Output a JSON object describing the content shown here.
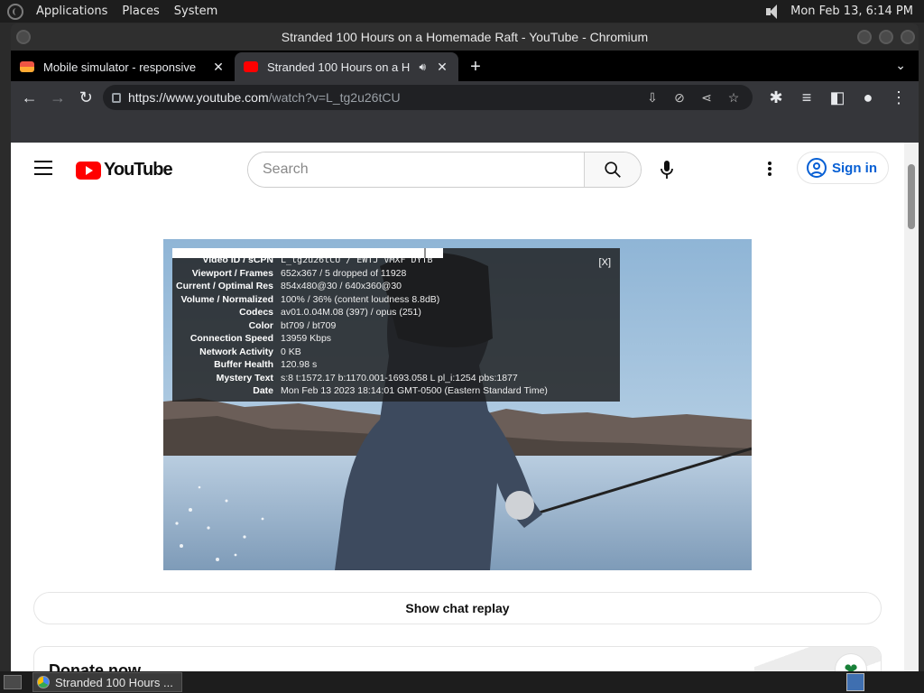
{
  "top_panel": {
    "menu": [
      "Applications",
      "Places",
      "System"
    ],
    "clock": "Mon Feb 13,  6:14 PM"
  },
  "window": {
    "title": "Stranded 100 Hours on a Homemade Raft - YouTube - Chromium"
  },
  "tabs": [
    {
      "label": "Mobile simulator - responsive",
      "active": false,
      "icon": "mobile-simulator-favicon"
    },
    {
      "label": "Stranded 100 Hours on a H",
      "active": true,
      "icon": "youtube-favicon",
      "audio": true
    }
  ],
  "toolbar": {
    "url_host": "https://www.youtube.com",
    "url_path": "/watch?v=L_tg2u26tCU"
  },
  "youtube": {
    "logo_text": "YouTube",
    "search_placeholder": "Search",
    "sign_in_label": "Sign in",
    "show_chat_replay": "Show chat replay",
    "donate_title": "Donate now"
  },
  "stats": {
    "close_label": "[X]",
    "rows": [
      {
        "label": "Video ID / sCPN",
        "value": "L_tg2u26tCU / EWTJ VMXF DYTB"
      },
      {
        "label": "Viewport / Frames",
        "value": "652x367 / 5 dropped of 11928"
      },
      {
        "label": "Current / Optimal Res",
        "value": "854x480@30 / 640x360@30"
      },
      {
        "label": "Volume / Normalized",
        "value": "100% / 36% (content loudness 8.8dB)"
      },
      {
        "label": "Codecs",
        "value": "av01.0.04M.08 (397) / opus (251)"
      },
      {
        "label": "Color",
        "value": "bt709 / bt709"
      },
      {
        "label": "Connection Speed",
        "value": "13959 Kbps"
      },
      {
        "label": "Network Activity",
        "value": "0 KB"
      },
      {
        "label": "Buffer Health",
        "value": "120.98 s"
      },
      {
        "label": "Mystery Text",
        "value": "s:8 t:1572.17 b:1170.001-1693.058 L pl_i:1254 pbs:1877"
      },
      {
        "label": "Date",
        "value": "Mon Feb 13 2023 18:14:01 GMT-0500 (Eastern Standard Time)"
      }
    ]
  },
  "taskbar": {
    "task_label": "Stranded 100 Hours ..."
  },
  "colors": {
    "youtube_red": "#ff0000",
    "sign_in_blue": "#065fd4",
    "conn_bar": "#6cc5a5"
  }
}
